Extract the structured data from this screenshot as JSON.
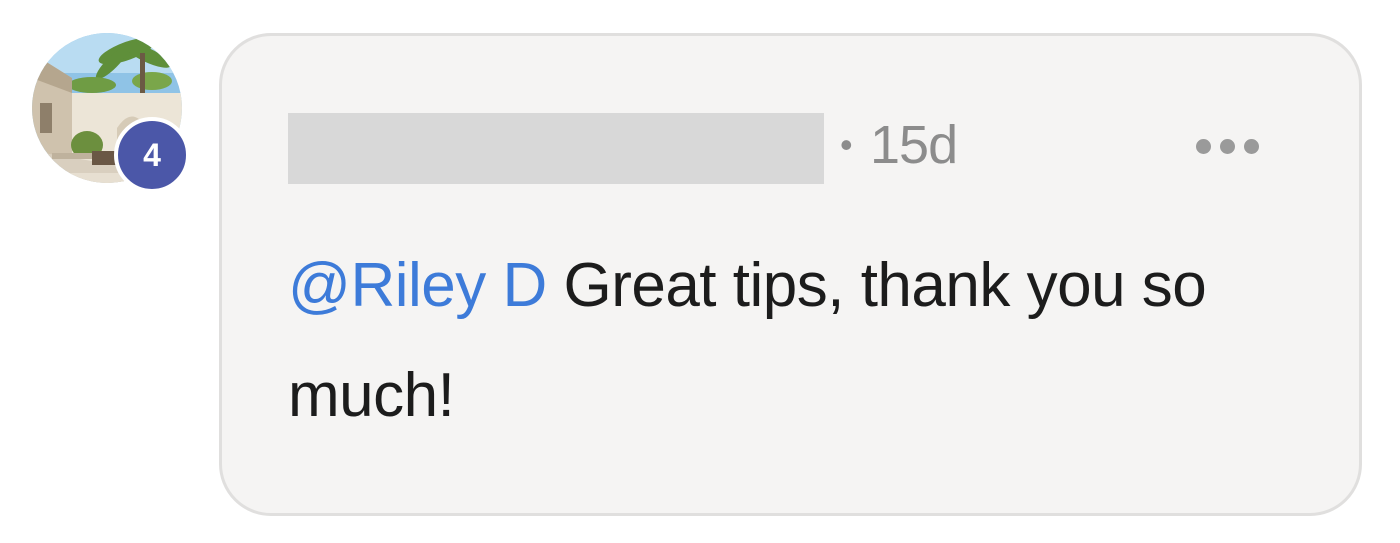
{
  "avatar": {
    "badge_count": "4"
  },
  "comment": {
    "author_name": "",
    "separator": "•",
    "time_ago": "15d",
    "more_icon": "more-horizontal-icon",
    "mention": "@Riley D",
    "text": " Great tips, thank you so much!"
  },
  "colors": {
    "bubble_bg": "#f5f4f3",
    "bubble_border": "#e0dfde",
    "mention": "#3d7bd9",
    "badge": "#4b57a8",
    "muted": "#8c8c8c",
    "text": "#1c1c1c"
  }
}
